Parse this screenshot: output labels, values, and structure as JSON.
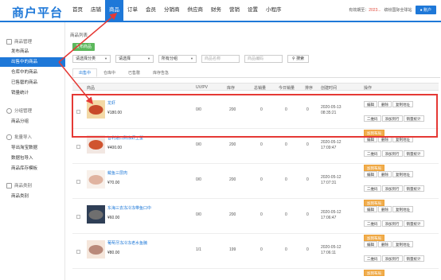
{
  "header": {
    "brand": "商户平台",
    "nav": [
      "首页",
      "店铺",
      "商品",
      "订单",
      "会员",
      "分销商",
      "供应商",
      "财务",
      "营销",
      "设置",
      "小程序"
    ],
    "nav_active_index": 2,
    "store_prefix": "有效期至：",
    "store_date": "2023...",
    "store_name": "缤纷国际全球站",
    "user_label": "账户"
  },
  "sidebar": {
    "groups": [
      {
        "label": "商品管理",
        "icon": "box-icon",
        "items": [
          "发布商品",
          "出售中的商品",
          "仓库中的商品",
          "已售罄的商品",
          "销量统计"
        ]
      },
      {
        "label": "分组管理",
        "icon": "tag-icon",
        "items": [
          "商品分组"
        ]
      },
      {
        "label": "批量导入",
        "icon": "cloud-upload-icon",
        "items": [
          "导出淘宝数据",
          "数据包导入",
          "商品库存模板"
        ]
      },
      {
        "label": "商品类别",
        "icon": "layers-icon",
        "items": [
          "商品类别"
        ]
      }
    ],
    "active_item": "出售中的商品"
  },
  "main": {
    "breadcrumb": "商品列表",
    "publish_button": "发布商品",
    "filters": {
      "category": "请选择分类",
      "group": "请选择",
      "sort": "所有分组",
      "name_placeholder": "商品名称",
      "code_placeholder": "商品编码",
      "search_label": "搜索"
    },
    "tabs": [
      "出售中",
      "仓库中",
      "已售罄",
      "库存告急"
    ],
    "active_tab": 0,
    "columns": [
      "商品",
      "UV/PV",
      "库存",
      "总销量",
      "今日销量",
      "排序",
      "创建时间",
      "操作"
    ],
    "rows": [
      {
        "name": "龙虾",
        "price": "¥180.00",
        "uvpv": "0/0",
        "stock": "200",
        "total": "0",
        "today": "0",
        "sort": "0",
        "date": "2020-05-13",
        "time": "08:35:21",
        "thumb": "lobster"
      },
      {
        "name": "智利进口熟冻虾王蟹",
        "price": "¥400.00",
        "uvpv": "0/0",
        "stock": "200",
        "total": "0",
        "today": "0",
        "sort": "0",
        "date": "2020-05-12",
        "time": "17:09:47",
        "thumb": "crab"
      },
      {
        "name": "鲅鱼三层肉",
        "price": "¥70.00",
        "uvpv": "0/0",
        "stock": "200",
        "total": "0",
        "today": "0",
        "sort": "0",
        "date": "2020-05-12",
        "time": "17:07:31",
        "thumb": "fish"
      },
      {
        "name": "东海三去冻冷冻带鱼口中",
        "price": "¥60.00",
        "uvpv": "0/0",
        "stock": "200",
        "total": "0",
        "today": "0",
        "sort": "0",
        "date": "2020-05-12",
        "time": "17:06:47",
        "thumb": "beltfish"
      },
      {
        "name": "葡萄牙冻冷冻老水鱼腩",
        "price": "¥80.00",
        "uvpv": "1/1",
        "stock": "199",
        "total": "0",
        "today": "0",
        "sort": "0",
        "date": "2020-05-12",
        "time": "17:06:11",
        "thumb": "fish2"
      }
    ],
    "row_actions": [
      "编辑",
      "删除",
      "复制地址",
      "二维码",
      "添加到行",
      "销量统计",
      "加到布局"
    ]
  },
  "colors": {
    "accent": "#1e78d8",
    "highlight": "#e53935",
    "publish": "#5cb85c",
    "orange": "#f0ad4e"
  }
}
